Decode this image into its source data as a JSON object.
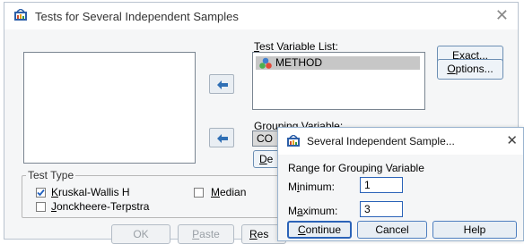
{
  "main_dialog": {
    "title": "Tests for Several Independent Samples",
    "close_glyph": "✕"
  },
  "test_variable_list": {
    "label": "Test Variable List:",
    "items": [
      {
        "label": "METHOD",
        "icon": "nominal-variable-icon"
      }
    ]
  },
  "grouping_variable": {
    "label": "Grouping Variable:",
    "value": "CO",
    "define_button_partial": "De"
  },
  "side_buttons": {
    "exact": "Exact...",
    "options": "Options..."
  },
  "test_type": {
    "legend": "Test Type",
    "kruskal_wallis": {
      "label": "Kruskal-Wallis H",
      "checked": true
    },
    "median": {
      "label": "Median",
      "checked": false
    },
    "jonckheere_terpstra": {
      "label": "Jonckheere-Terpstra",
      "checked": false
    }
  },
  "bottom_buttons": {
    "ok": "OK",
    "paste": "Paste",
    "reset_partial": "Res"
  },
  "sub_dialog": {
    "title": "Several Independent Sample...",
    "close_glyph": "✕",
    "range_label": "Range for Grouping Variable",
    "minimum_label": "Minimum:",
    "minimum_value": "1",
    "maximum_label": "Maximum:",
    "maximum_value": "3",
    "continue": "Continue",
    "cancel": "Cancel",
    "help": "Help"
  },
  "colors": {
    "accent": "#2b63b8",
    "arrow": "#2f6fb5",
    "selection": "#c7c7c7"
  }
}
